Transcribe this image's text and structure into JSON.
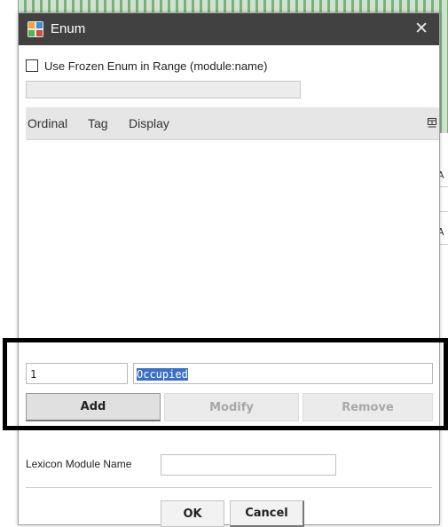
{
  "background": {
    "right_labels": [
      "A",
      "A"
    ]
  },
  "dialog": {
    "title": "Enum",
    "icon": "enum-app-icon",
    "close_glyph": "✕"
  },
  "frozen": {
    "checked": false,
    "label": "Use Frozen Enum in Range (module:name)"
  },
  "range_field": {
    "value": "",
    "enabled": false
  },
  "table": {
    "columns": [
      "Ordinal",
      "Tag",
      "Display"
    ],
    "rows": []
  },
  "editor": {
    "ordinal_value": "1",
    "tag_value": "Occupied"
  },
  "buttons": {
    "add": "Add",
    "modify": "Modify",
    "remove": "Remove",
    "ok": "OK",
    "cancel": "Cancel"
  },
  "lexicon": {
    "label": "Lexicon Module Name",
    "value": ""
  },
  "colors": {
    "titlebar": "#414141",
    "selection": "#3b6fc7",
    "highlight_border": "#000000"
  }
}
